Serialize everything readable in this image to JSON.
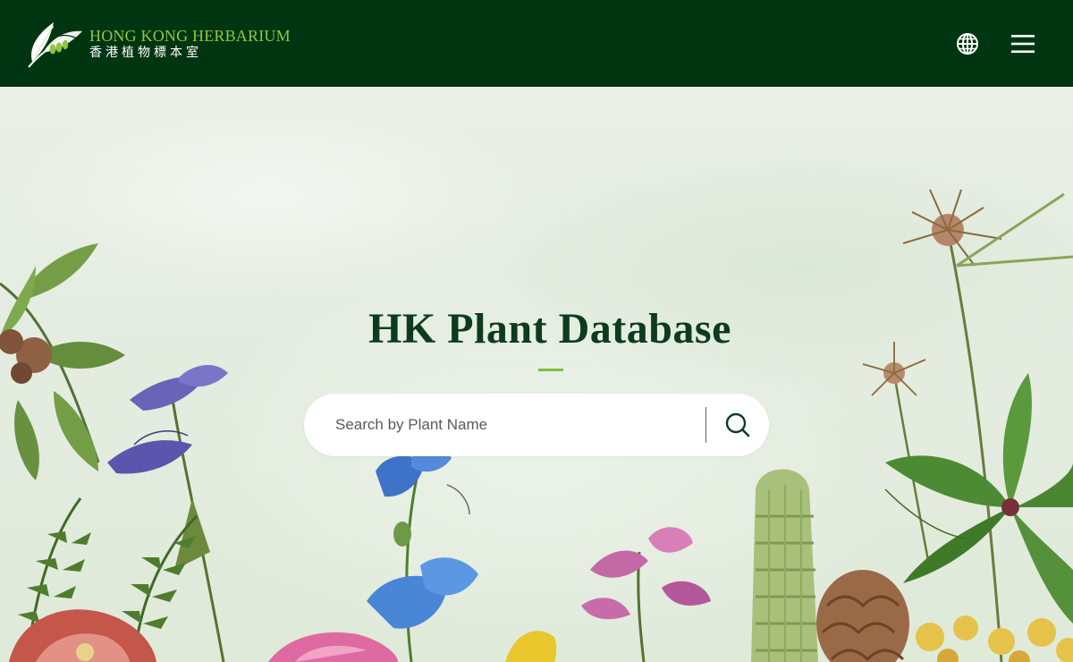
{
  "header": {
    "brand_en": "HONG KONG HERBARIUM",
    "brand_zh": "香港植物標本室",
    "logo_icon": "leaf-logo-icon",
    "language_icon": "globe-icon",
    "menu_icon": "hamburger-menu-icon"
  },
  "hero": {
    "title": "HK Plant Database",
    "search": {
      "placeholder": "Search by Plant Name",
      "value": "",
      "icon": "search-icon"
    }
  },
  "colors": {
    "header_bg": "#003512",
    "brand_green": "#8fc63f",
    "title_color": "#0d3b1e",
    "accent_rule": "#7bbf44"
  }
}
